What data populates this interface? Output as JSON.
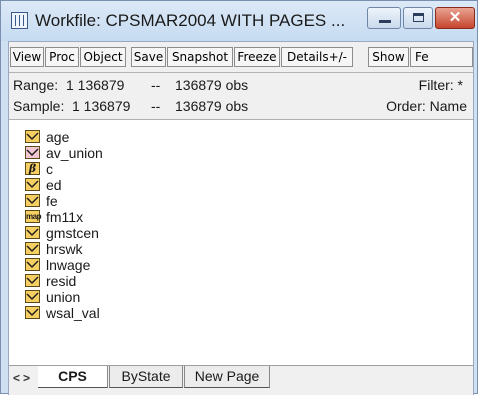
{
  "window": {
    "title": "Workfile: CPSMAR2004 WITH PAGES ...",
    "close_symbol": "✕"
  },
  "toolbar": {
    "buttons": [
      "View",
      "Proc",
      "Object",
      "Save",
      "Snapshot",
      "Freeze",
      "Details+/-",
      "Show",
      "Fe"
    ]
  },
  "info": {
    "range_label": "Range:",
    "range_value": "1 136879",
    "range_sep": "--",
    "range_obs": "136879 obs",
    "filter": "Filter: *",
    "sample_label": "Sample:",
    "sample_value": "1 136879",
    "sample_sep": "--",
    "sample_obs": "136879 obs",
    "order": "Order: Name"
  },
  "objects": [
    {
      "name": "age",
      "type": "series",
      "icon": "series-icon"
    },
    {
      "name": "av_union",
      "type": "alpha-series",
      "icon": "alpha-series-icon"
    },
    {
      "name": "c",
      "type": "coefficient",
      "icon": "coef-icon",
      "glyph": "β"
    },
    {
      "name": "ed",
      "type": "series",
      "icon": "series-icon"
    },
    {
      "name": "fe",
      "type": "series",
      "icon": "series-icon"
    },
    {
      "name": "fm11x",
      "type": "model",
      "icon": "model-icon",
      "glyph": "map"
    },
    {
      "name": "gmstcen",
      "type": "series",
      "icon": "series-icon"
    },
    {
      "name": "hrswk",
      "type": "series",
      "icon": "series-icon"
    },
    {
      "name": "lnwage",
      "type": "series",
      "icon": "series-icon"
    },
    {
      "name": "resid",
      "type": "series",
      "icon": "series-icon"
    },
    {
      "name": "union",
      "type": "series",
      "icon": "series-icon"
    },
    {
      "name": "wsal_val",
      "type": "series",
      "icon": "series-icon"
    }
  ],
  "tabs": {
    "scroll_left": "<",
    "scroll_right": ">",
    "items": [
      "CPS",
      "ByState",
      "New Page"
    ],
    "active": "CPS"
  },
  "colors": {
    "series_icon": "#f6cf62",
    "alpha_icon": "#f2c7d4",
    "close_button": "#c6452d"
  }
}
